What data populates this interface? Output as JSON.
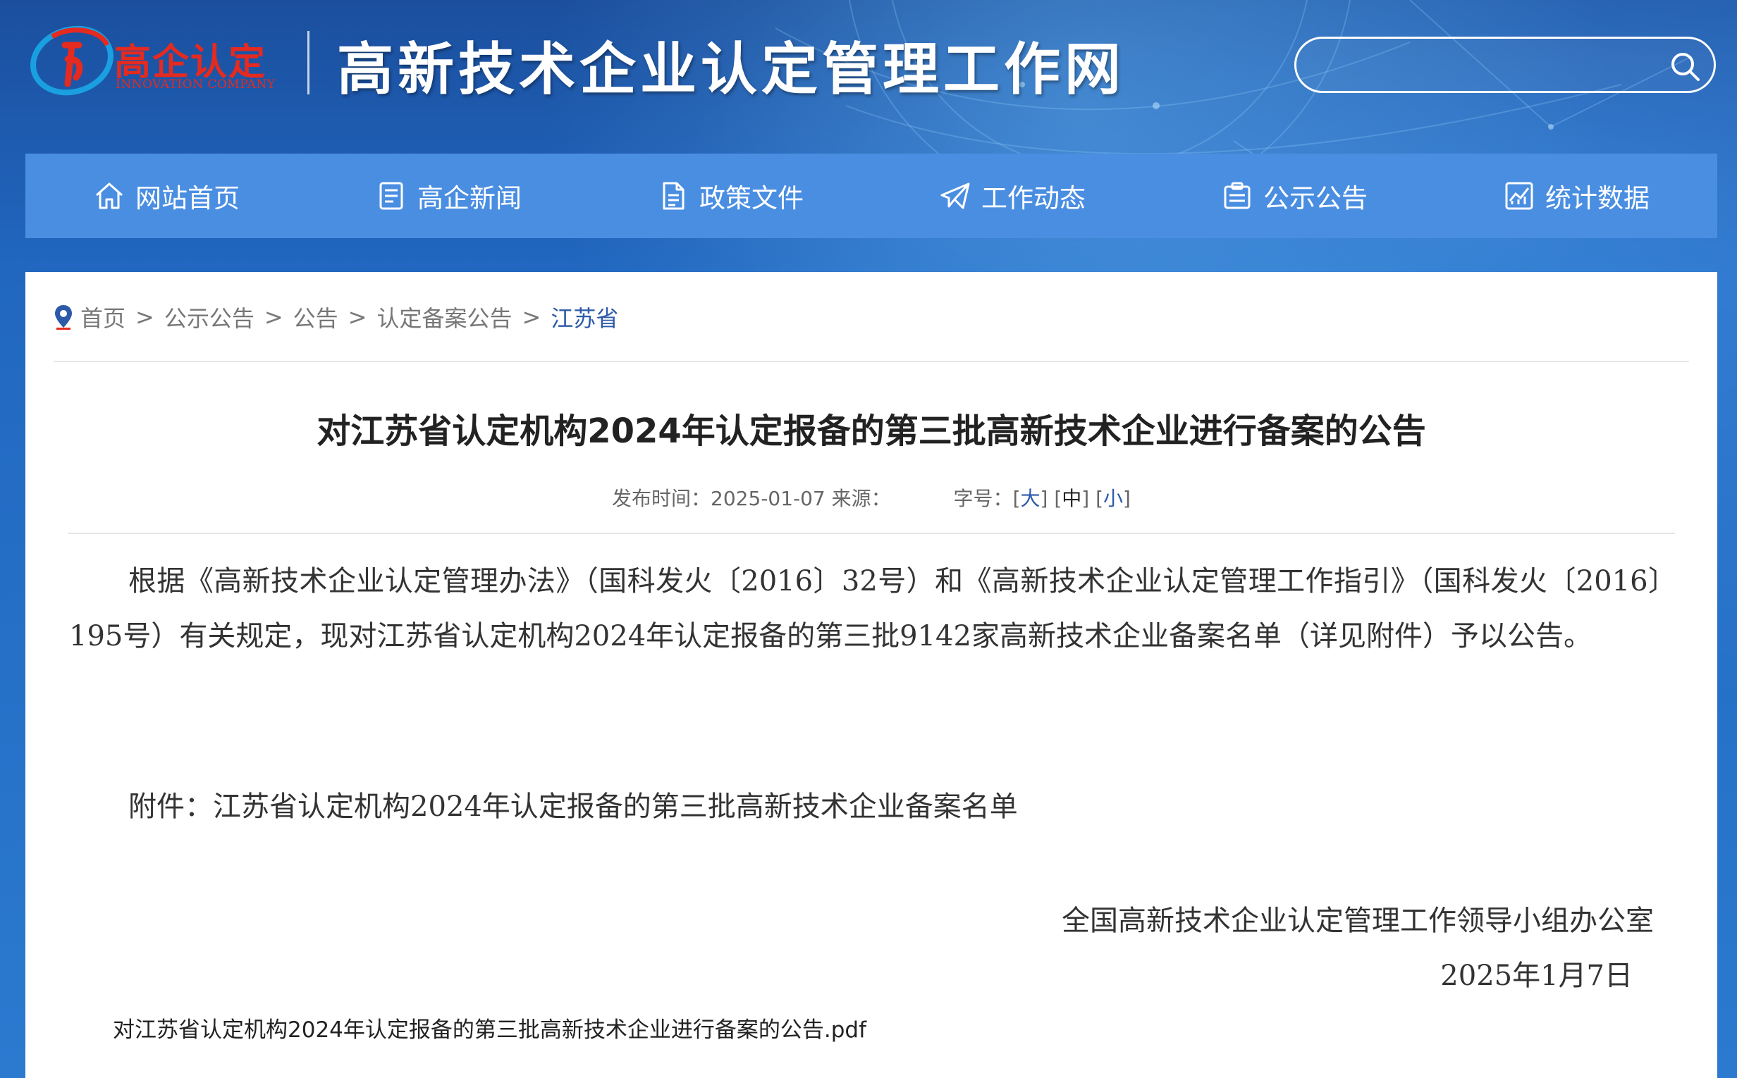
{
  "header": {
    "logo_cn": "高企认定",
    "logo_en": "INNOVATION COMPANY",
    "site_title": "高新技术企业认定管理工作网",
    "search_placeholder": ""
  },
  "nav": {
    "items": [
      {
        "label": "网站首页",
        "icon": "home-icon"
      },
      {
        "label": "高企新闻",
        "icon": "news-icon"
      },
      {
        "label": "政策文件",
        "icon": "document-icon"
      },
      {
        "label": "工作动态",
        "icon": "paper-plane-icon"
      },
      {
        "label": "公示公告",
        "icon": "clipboard-icon"
      },
      {
        "label": "统计数据",
        "icon": "chart-icon"
      }
    ]
  },
  "breadcrumb": {
    "items": [
      "首页",
      "公示公告",
      "公告",
      "认定备案公告"
    ],
    "current": "江苏省"
  },
  "article": {
    "title": "对江苏省认定机构2024年认定报备的第三批高新技术企业进行备案的公告",
    "meta_publish": "发布时间：2025-01-07 来源：",
    "font_size_label": "字号：",
    "font_size_large": "大",
    "font_size_medium": "中",
    "font_size_small": "小",
    "paragraph": "根据《高新技术企业认定管理办法》（国科发火〔2016〕32号）和《高新技术企业认定管理工作指引》（国科发火〔2016〕195号）有关规定，现对江苏省认定机构2024年认定报备的第三批9142家高新技术企业备案名单（详见附件）予以公告。",
    "attachment": "附件：江苏省认定机构2024年认定报备的第三批高新技术企业备案名单",
    "signer": "全国高新技术企业认定管理工作领导小组办公室",
    "date": "2025年1月7日",
    "pdf_link": "对江苏省认定机构2024年认定报备的第三批高新技术企业进行备案的公告.pdf"
  },
  "colors": {
    "nav_bg": "#4a8ee2",
    "header_bg": "#1b4f9e",
    "logo_red": "#e52a1f",
    "link_blue": "#2c5aa8"
  }
}
